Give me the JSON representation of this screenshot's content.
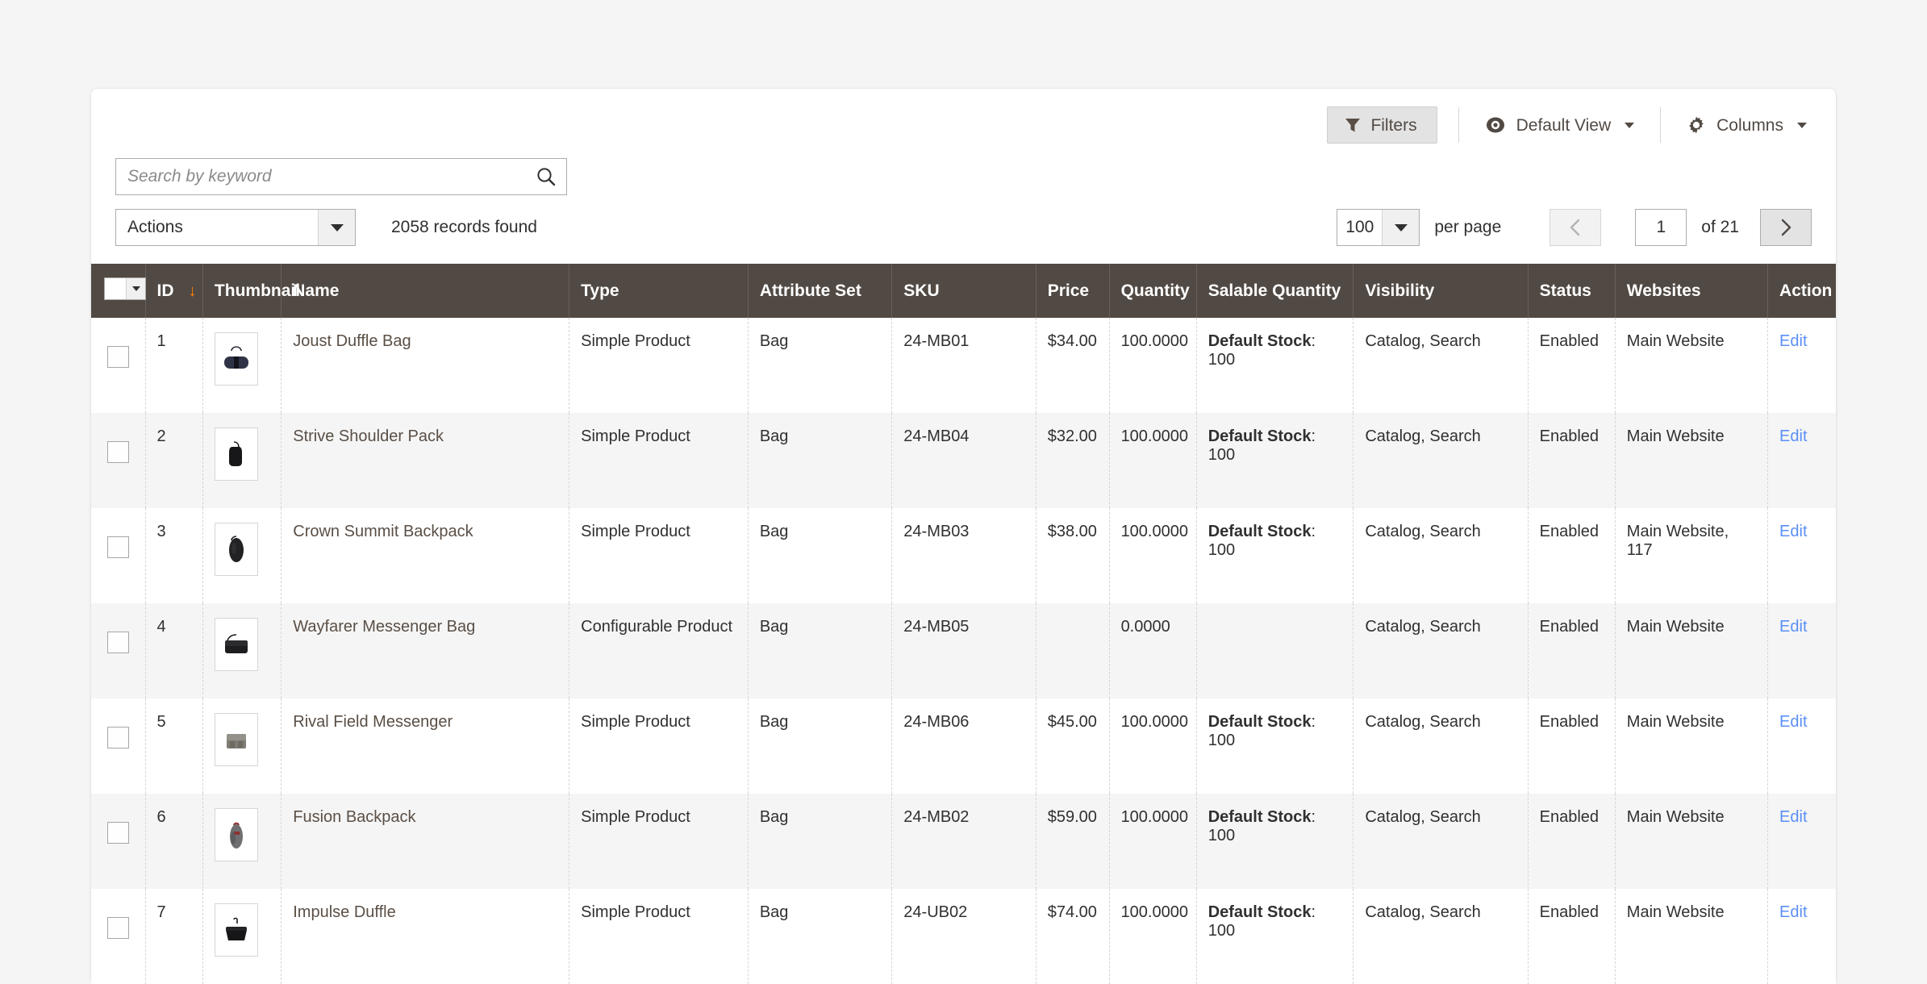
{
  "toolbar": {
    "filters_label": "Filters",
    "default_view_label": "Default View",
    "columns_label": "Columns"
  },
  "search": {
    "placeholder": "Search by keyword",
    "value": ""
  },
  "actions": {
    "select_label": "Actions",
    "records_found": "2058 records found"
  },
  "pagination": {
    "per_page_value": "100",
    "per_page_label": "per page",
    "current_page": "1",
    "of_label": "of 21"
  },
  "table": {
    "columns": [
      {
        "key": "check",
        "label": ""
      },
      {
        "key": "id",
        "label": "ID"
      },
      {
        "key": "thumb",
        "label": "Thumbnail"
      },
      {
        "key": "name",
        "label": "Name"
      },
      {
        "key": "type",
        "label": "Type"
      },
      {
        "key": "attr",
        "label": "Attribute Set"
      },
      {
        "key": "sku",
        "label": "SKU"
      },
      {
        "key": "price",
        "label": "Price"
      },
      {
        "key": "qty",
        "label": "Quantity"
      },
      {
        "key": "salable",
        "label": "Salable Quantity"
      },
      {
        "key": "vis",
        "label": "Visibility"
      },
      {
        "key": "status",
        "label": "Status"
      },
      {
        "key": "sites",
        "label": "Websites"
      },
      {
        "key": "action",
        "label": "Action"
      }
    ],
    "sort": {
      "column": "ID",
      "direction": "desc",
      "glyph": "↓"
    },
    "edit_label": "Edit",
    "rows": [
      {
        "id": "1",
        "name": "Joust Duffle Bag",
        "type": "Simple Product",
        "attribute_set": "Bag",
        "sku": "24-MB01",
        "price": "$34.00",
        "quantity": "100.0000",
        "salable_label": "Default Stock",
        "salable_value": ": 100",
        "visibility": "Catalog, Search",
        "status": "Enabled",
        "websites": "Main Website",
        "thumbnail": "duffle-bag-navy"
      },
      {
        "id": "2",
        "name": "Strive Shoulder Pack",
        "type": "Simple Product",
        "attribute_set": "Bag",
        "sku": "24-MB04",
        "price": "$32.00",
        "quantity": "100.0000",
        "salable_label": "Default Stock",
        "salable_value": ": 100",
        "visibility": "Catalog, Search",
        "status": "Enabled",
        "websites": "Main Website",
        "thumbnail": "shoulder-pack-black"
      },
      {
        "id": "3",
        "name": "Crown Summit Backpack",
        "type": "Simple Product",
        "attribute_set": "Bag",
        "sku": "24-MB03",
        "price": "$38.00",
        "quantity": "100.0000",
        "salable_label": "Default Stock",
        "salable_value": ": 100",
        "visibility": "Catalog, Search",
        "status": "Enabled",
        "websites": "Main Website, 117",
        "thumbnail": "backpack-black"
      },
      {
        "id": "4",
        "name": "Wayfarer Messenger Bag",
        "type": "Configurable Product",
        "attribute_set": "Bag",
        "sku": "24-MB05",
        "price": "",
        "quantity": "0.0000",
        "salable_label": "",
        "salable_value": "",
        "visibility": "Catalog, Search",
        "status": "Enabled",
        "websites": "Main Website",
        "thumbnail": "messenger-bag-black"
      },
      {
        "id": "5",
        "name": "Rival Field Messenger",
        "type": "Simple Product",
        "attribute_set": "Bag",
        "sku": "24-MB06",
        "price": "$45.00",
        "quantity": "100.0000",
        "salable_label": "Default Stock",
        "salable_value": ": 100",
        "visibility": "Catalog, Search",
        "status": "Enabled",
        "websites": "Main Website",
        "thumbnail": "field-messenger-grey"
      },
      {
        "id": "6",
        "name": "Fusion Backpack",
        "type": "Simple Product",
        "attribute_set": "Bag",
        "sku": "24-MB02",
        "price": "$59.00",
        "quantity": "100.0000",
        "salable_label": "Default Stock",
        "salable_value": ": 100",
        "visibility": "Catalog, Search",
        "status": "Enabled",
        "websites": "Main Website",
        "thumbnail": "fusion-backpack-grey"
      },
      {
        "id": "7",
        "name": "Impulse Duffle",
        "type": "Simple Product",
        "attribute_set": "Bag",
        "sku": "24-UB02",
        "price": "$74.00",
        "quantity": "100.0000",
        "salable_label": "Default Stock",
        "salable_value": ": 100",
        "visibility": "Catalog, Search",
        "status": "Enabled",
        "websites": "Main Website",
        "thumbnail": "impulse-duffle-black"
      }
    ]
  },
  "colors": {
    "header_bg": "#514943",
    "page_bg": "#f5f5f5",
    "link": "#5b8ff7",
    "sort_accent": "#ff8400",
    "name_link": "#5a4f46"
  },
  "icons": {
    "filter": "filter-icon",
    "eye": "eye-icon",
    "gear": "gear-icon",
    "search": "search-icon",
    "chevron_left": "chevron-left-icon",
    "chevron_right": "chevron-right-icon"
  }
}
